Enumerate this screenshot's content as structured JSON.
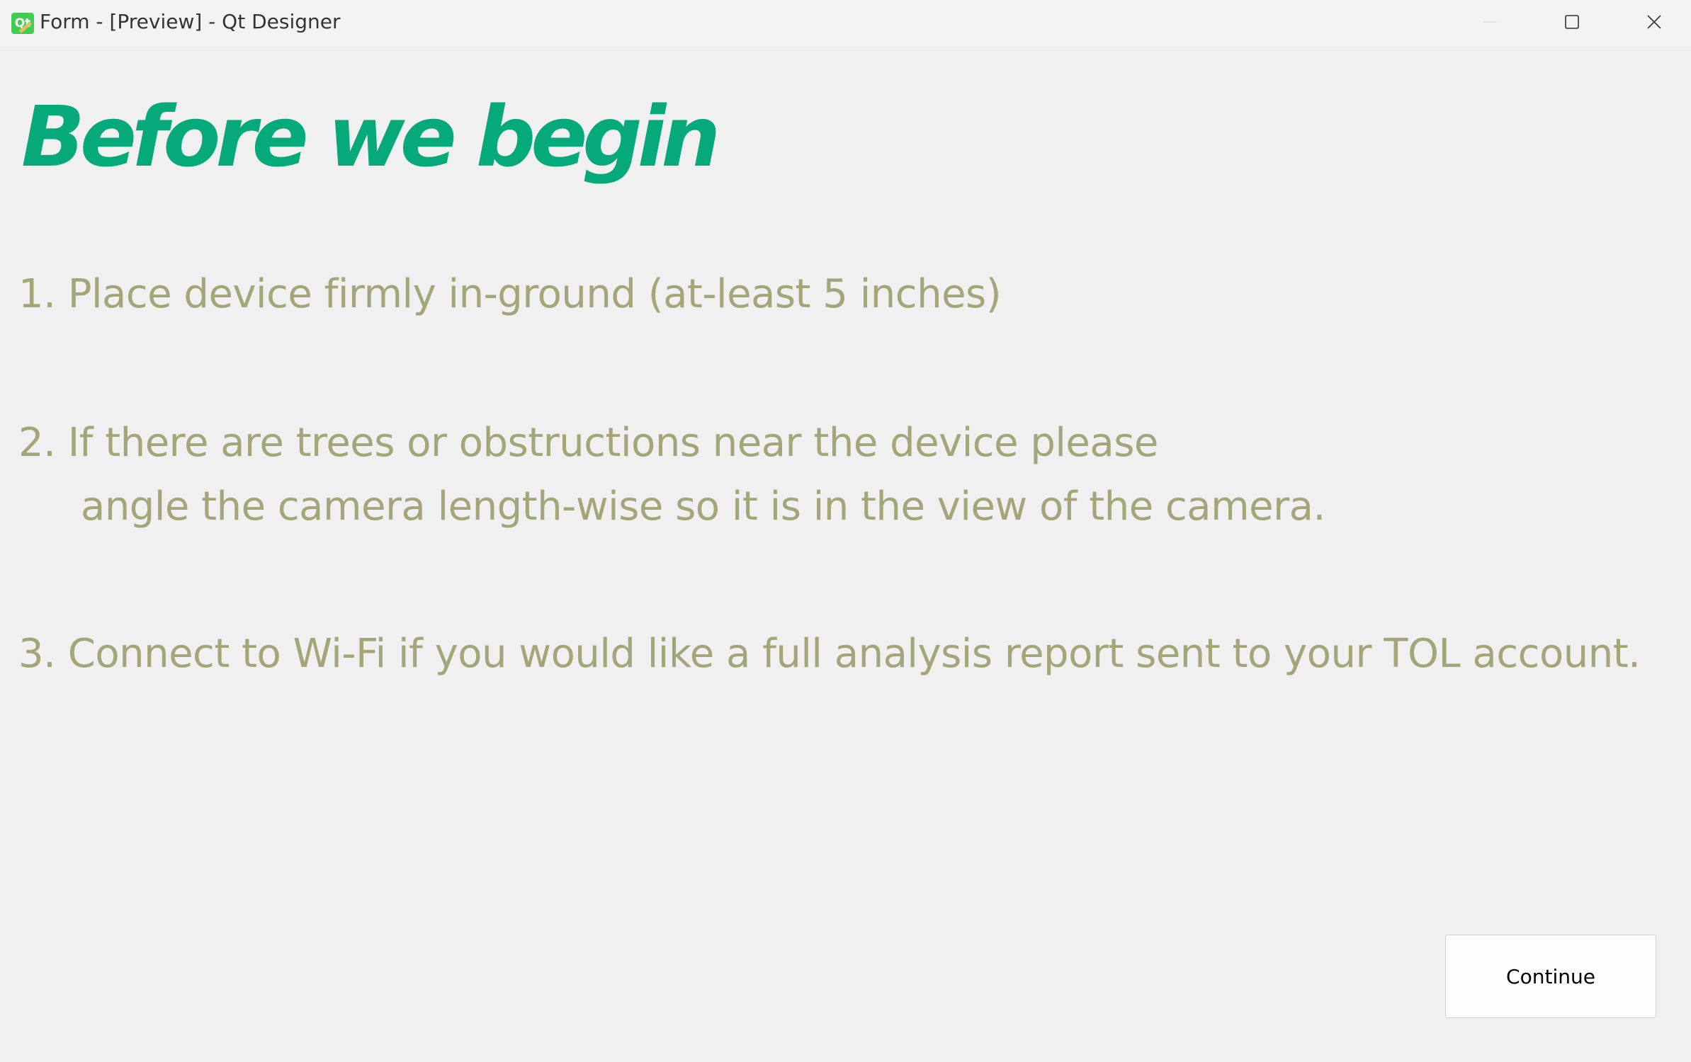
{
  "window": {
    "title": "Form - [Preview] - Qt Designer",
    "app_icon_label": "Qt"
  },
  "heading": "Before we begin",
  "steps": {
    "step1": "1. Place device firmly in-ground (at-least 5 inches)",
    "step2_line1": "2. If there are trees or obstructions near the device please",
    "step2_line2": "angle the camera length-wise so it is in the view of the camera.",
    "step3": "3. Connect to Wi-Fi if you would like a full analysis report sent to your TOL account."
  },
  "buttons": {
    "continue": "Continue"
  },
  "colors": {
    "heading": "#06a97a",
    "steps": "#a5a57a",
    "background": "#f0f0f0"
  },
  "icons": {
    "minimize": "minimize-icon",
    "maximize": "maximize-icon",
    "close": "close-icon",
    "app": "qt-designer-icon"
  }
}
